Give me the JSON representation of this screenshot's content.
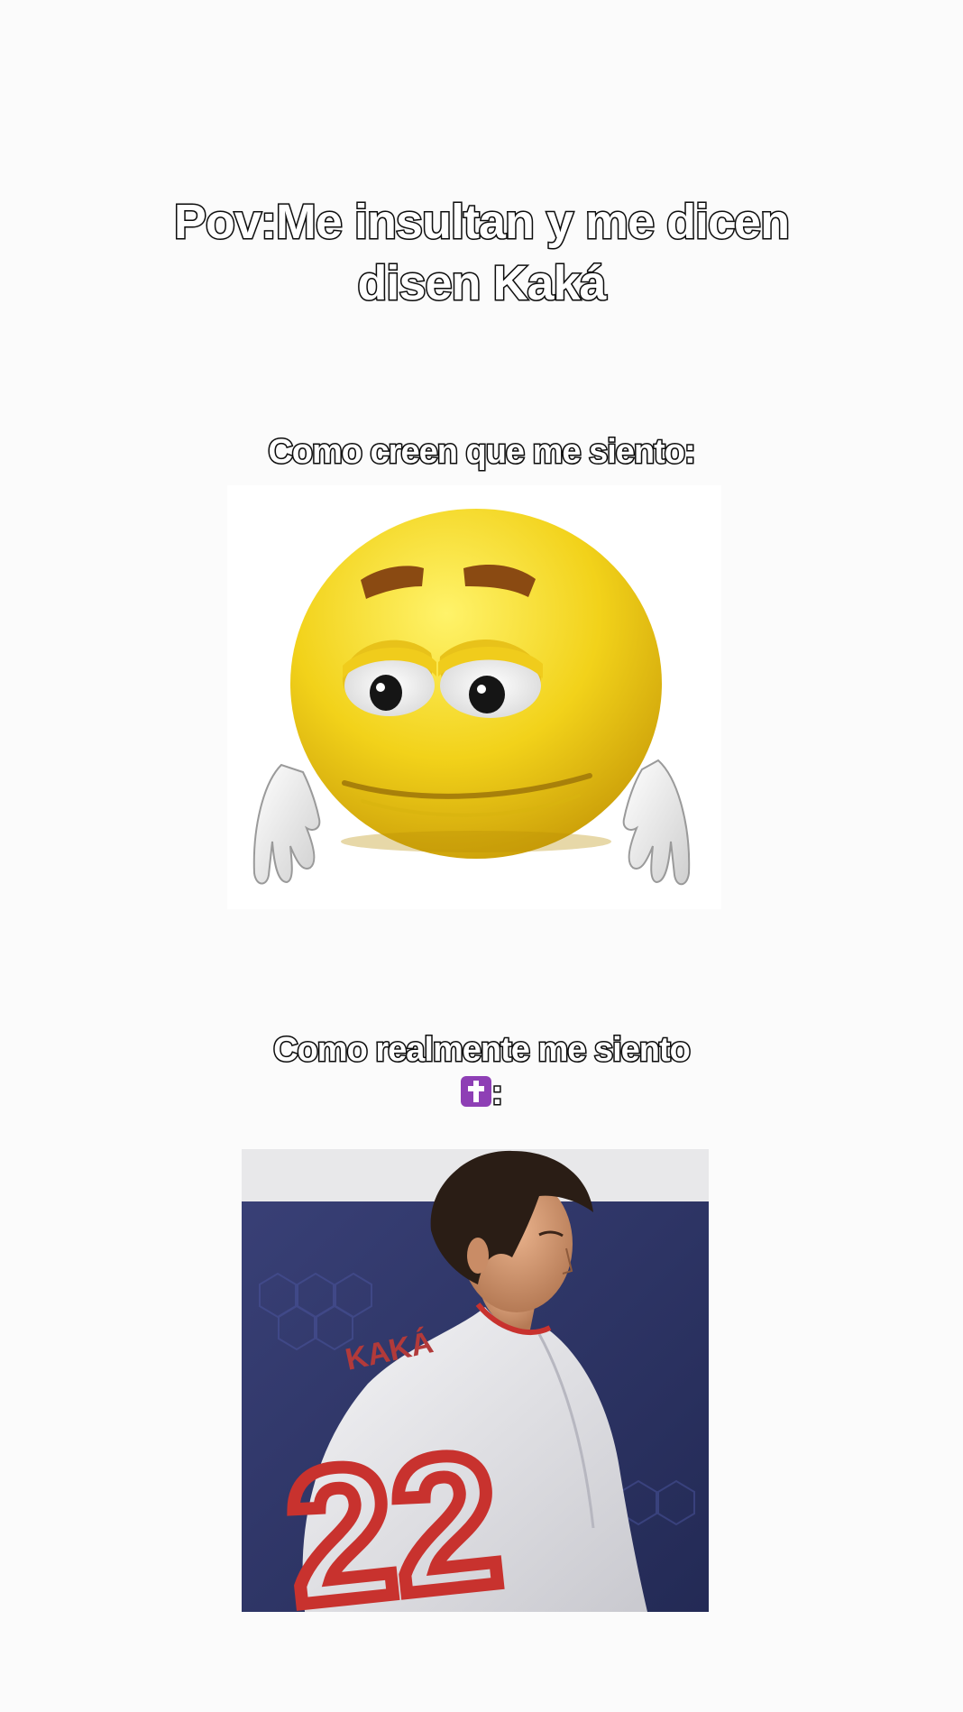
{
  "title": {
    "line1": "Pov:Me insultan y me dicen",
    "line2": "disen Kaká"
  },
  "caption_expected": "Como creen que me siento:",
  "caption_real": {
    "line1": "Como realmente me siento",
    "line2_suffix": ":"
  },
  "images": {
    "emoji": "sad-droopy-emoji-with-gloved-hands",
    "photo": "football-player-number-22-looking-back"
  },
  "photo_shirt": {
    "number": "22",
    "name": "KAKÁ"
  },
  "colors": {
    "background": "#fbfbfb",
    "emoji_yellow": "#f2d21a",
    "cross_badge": "#8e3fb5",
    "jersey_red": "#c8322e"
  }
}
